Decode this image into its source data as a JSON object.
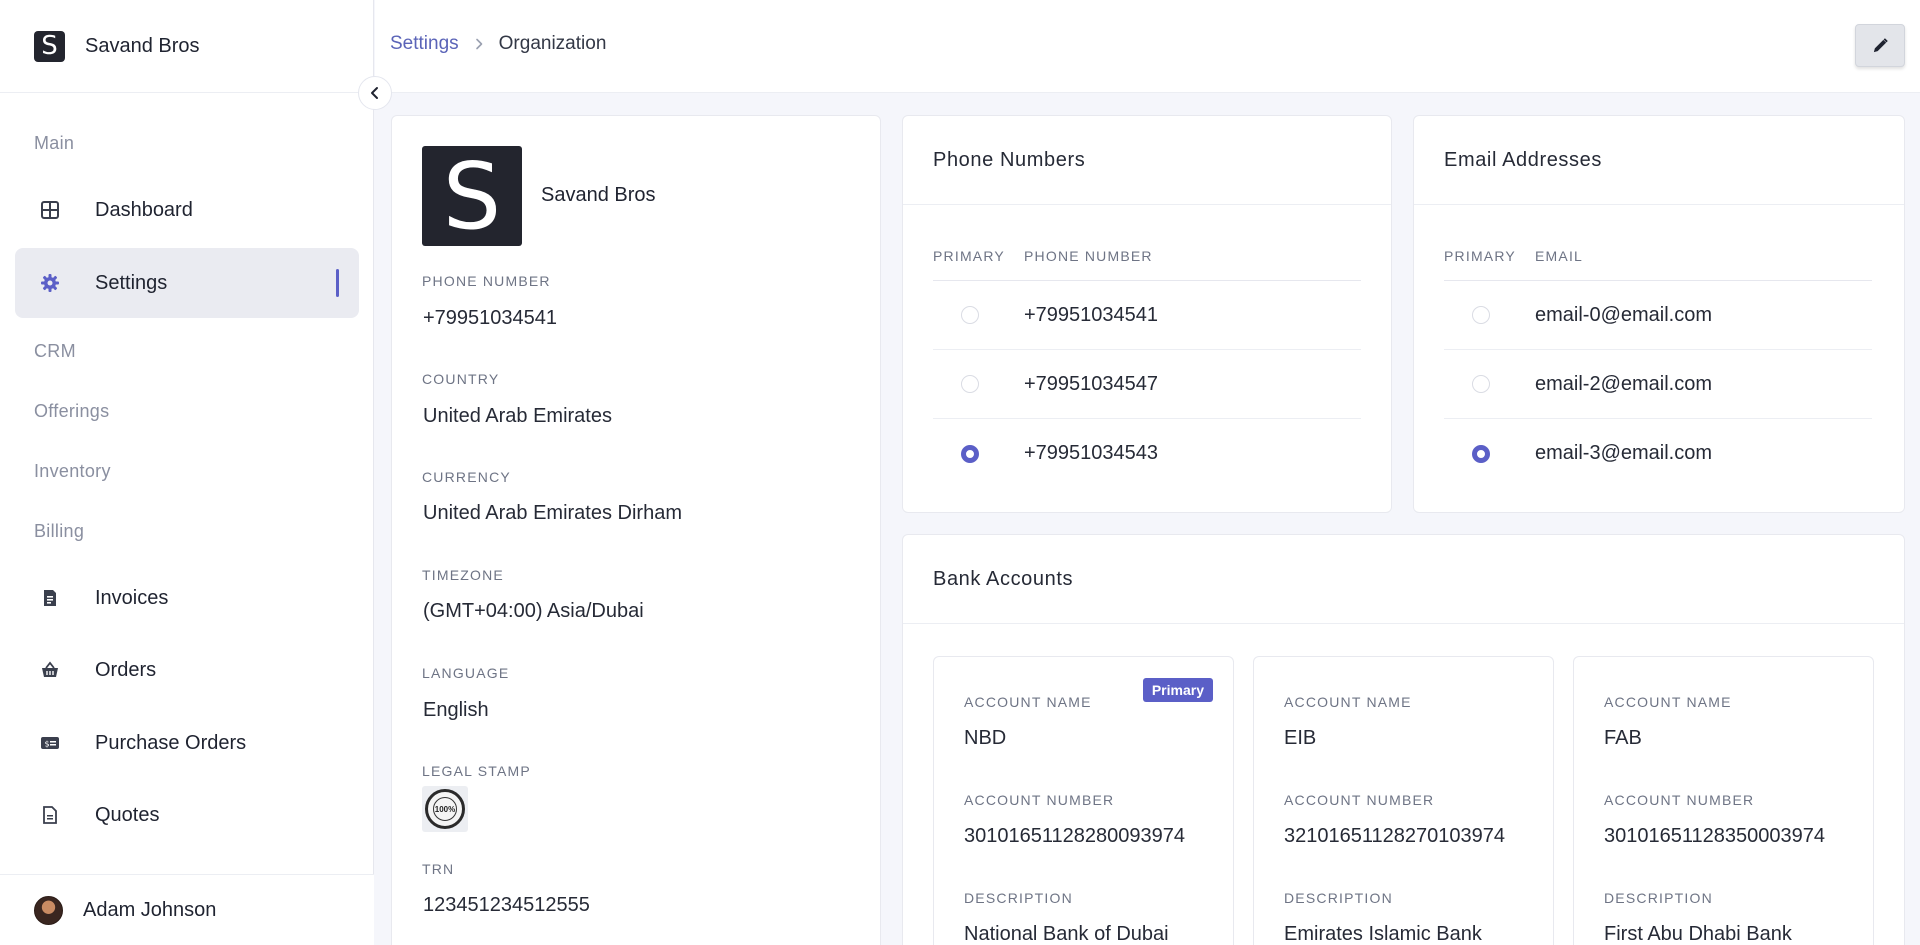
{
  "app": {
    "name": "Savand Bros",
    "logo_letter": "S"
  },
  "sidebar": {
    "sections": {
      "main": "Main",
      "crm": "CRM",
      "offerings": "Offerings",
      "inventory": "Inventory",
      "billing": "Billing"
    },
    "items": {
      "dashboard": "Dashboard",
      "settings": "Settings",
      "invoices": "Invoices",
      "orders": "Orders",
      "purchase_orders": "Purchase Orders",
      "quotes": "Quotes"
    },
    "active_item": "settings",
    "user": {
      "name": "Adam Johnson"
    }
  },
  "breadcrumb": {
    "parent": "Settings",
    "current": "Organization"
  },
  "profile": {
    "logo_letter": "S",
    "name": "Savand Bros",
    "phone_label": "PHONE NUMBER",
    "phone": "+79951034541",
    "country_label": "COUNTRY",
    "country": "United Arab Emirates",
    "currency_label": "CURRENCY",
    "currency": "United Arab Emirates Dirham",
    "timezone_label": "TIMEZONE",
    "timezone": "(GMT+04:00) Asia/Dubai",
    "language_label": "LANGUAGE",
    "language": "English",
    "stamp_label": "LEGAL STAMP",
    "stamp_text": "100%",
    "trn_label": "TRN",
    "trn": "123451234512555"
  },
  "phones": {
    "title": "Phone Numbers",
    "col_primary": "PRIMARY",
    "col_value": "PHONE NUMBER",
    "rows": [
      {
        "value": "+79951034541",
        "primary": false
      },
      {
        "value": "+79951034547",
        "primary": false
      },
      {
        "value": "+79951034543",
        "primary": true
      }
    ]
  },
  "emails": {
    "title": "Email Addresses",
    "col_primary": "PRIMARY",
    "col_value": "EMAIL",
    "rows": [
      {
        "value": "email-0@email.com",
        "primary": false
      },
      {
        "value": "email-2@email.com",
        "primary": false
      },
      {
        "value": "email-3@email.com",
        "primary": true
      }
    ]
  },
  "banks": {
    "title": "Bank Accounts",
    "labels": {
      "name": "ACCOUNT NAME",
      "number": "ACCOUNT NUMBER",
      "description": "DESCRIPTION"
    },
    "primary_badge": "Primary",
    "accounts": [
      {
        "name": "NBD",
        "number": "30101651128280093974",
        "description": "National Bank of Dubai"
      },
      {
        "name": "EIB",
        "number": "32101651128270103974",
        "description": "Emirates Islamic Bank"
      },
      {
        "name": "FAB",
        "number": "30101651128350003974",
        "description": "First Abu Dhabi Bank"
      }
    ]
  },
  "colors": {
    "accent": "#5b5fc7",
    "dark": "#23252e"
  }
}
